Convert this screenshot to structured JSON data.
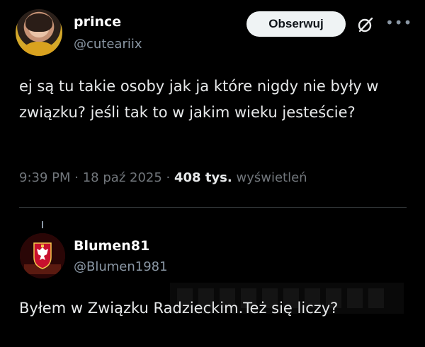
{
  "tweet": {
    "author_name": "prince",
    "author_handle": "@cuteariix",
    "follow_label": "Obserwuj",
    "text": "ej są tu takie osoby jak ja które nigdy nie były w związku? jeśli tak to w jakim wieku jesteście?",
    "time": "9:39 PM",
    "date": "18 paź 2025",
    "views_count": "408 tys.",
    "views_label": "wyświetleń",
    "separator": "·"
  },
  "reply": {
    "author_name": "Blumen81",
    "author_handle": "@Blumen1981",
    "text": "Byłem w Związku Radzieckim.Też się liczy?"
  },
  "icons": {
    "grok": "grok-slash-circle-icon",
    "more": "more-dots-icon",
    "avatar_reply": "polish-eagle-emblem"
  },
  "colors": {
    "background": "#000000",
    "text_primary": "#e7e9ea",
    "text_secondary": "#71767b",
    "button_bg": "#eff3f4"
  }
}
